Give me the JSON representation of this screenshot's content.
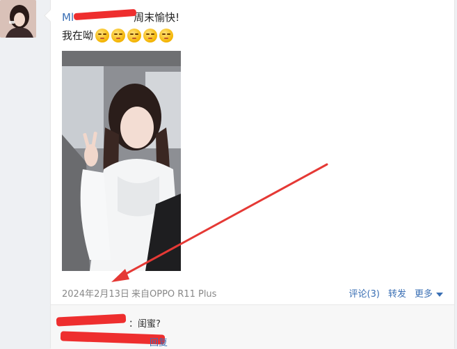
{
  "post": {
    "username": "Ml",
    "title_text": "周末愉快!",
    "body_text": "我在呦",
    "emojis": [
      "smile-icon",
      "smile-icon",
      "smile-icon",
      "smile-icon",
      "smile-icon"
    ]
  },
  "footer": {
    "date": "2024年2月13日",
    "source": "来自OPPO R11 Plus",
    "comment_label": "评论(3)",
    "repost_label": "转发",
    "more_label": "更多"
  },
  "comment": {
    "text": "：闺蜜?",
    "reply_label": "回复"
  },
  "colors": {
    "link": "#3a6fb4",
    "redaction": "#ee2e2e",
    "annotation_arrow": "#e53935"
  }
}
